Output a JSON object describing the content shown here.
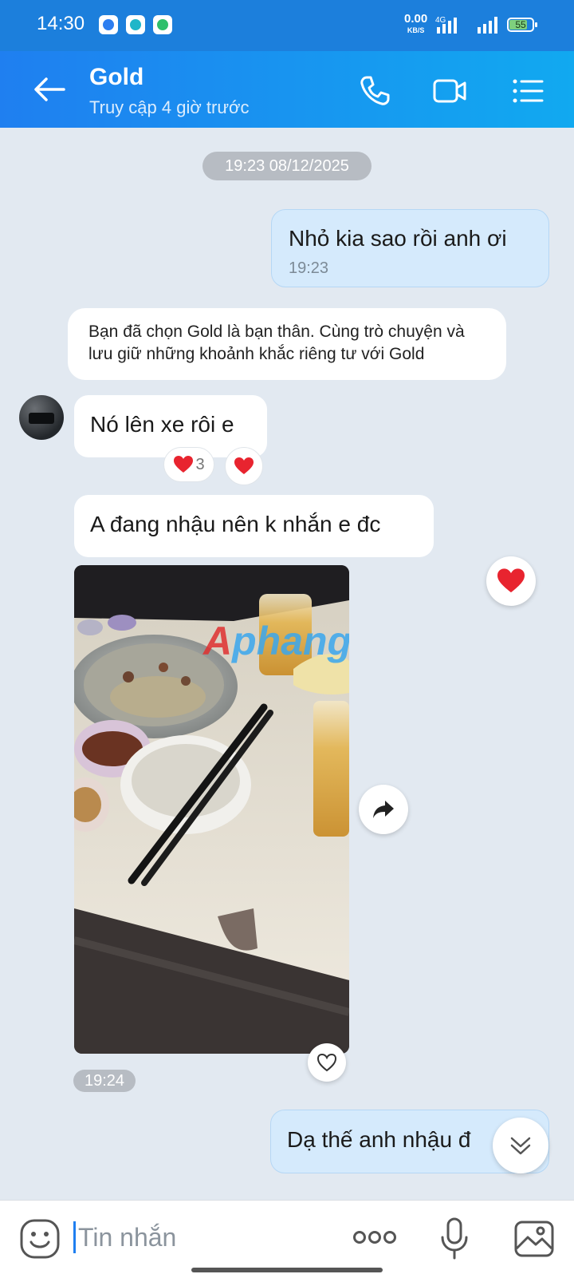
{
  "status_bar": {
    "time": "14:30",
    "net_speed": "0.00",
    "net_unit": "KB/S",
    "network_type": "4G",
    "battery": "55"
  },
  "header": {
    "contact_name": "Gold",
    "contact_status": "Truy cập 4 giờ trước"
  },
  "chat": {
    "date_divider": "19:23 08/12/2025",
    "messages": [
      {
        "direction": "out",
        "text": "Nhỏ kia sao rồi anh ơi",
        "time": "19:23"
      },
      {
        "direction": "system",
        "text": "Bạn đã chọn Gold là bạn thân. Cùng trò chuyện và lưu giữ những khoảnh khắc riêng tư với Gold"
      },
      {
        "direction": "in",
        "text": "Nó lên xe rôi e",
        "reaction_count": "3"
      },
      {
        "direction": "in",
        "text": "A đang nhậu nên k nhắn e đc"
      },
      {
        "direction": "in",
        "type": "photo",
        "watermark": "Aphang",
        "time": "19:24"
      },
      {
        "direction": "out",
        "text": "Dạ thế anh nhậu đ"
      }
    ]
  },
  "input": {
    "placeholder": "Tin nhắn"
  },
  "colors": {
    "header_start": "#1f7ff0",
    "header_end": "#11a9f0",
    "status_bar": "#1c7fdc",
    "chat_bg": "#e2e9f1",
    "outgoing_bubble": "#d5eafc",
    "heart": "#e8242f"
  },
  "icons": [
    "back-arrow-icon",
    "phone-icon",
    "video-call-icon",
    "menu-list-icon",
    "heart-icon",
    "forward-share-icon",
    "scroll-down-icon",
    "sticker-icon",
    "more-icon",
    "microphone-icon",
    "image-icon"
  ]
}
